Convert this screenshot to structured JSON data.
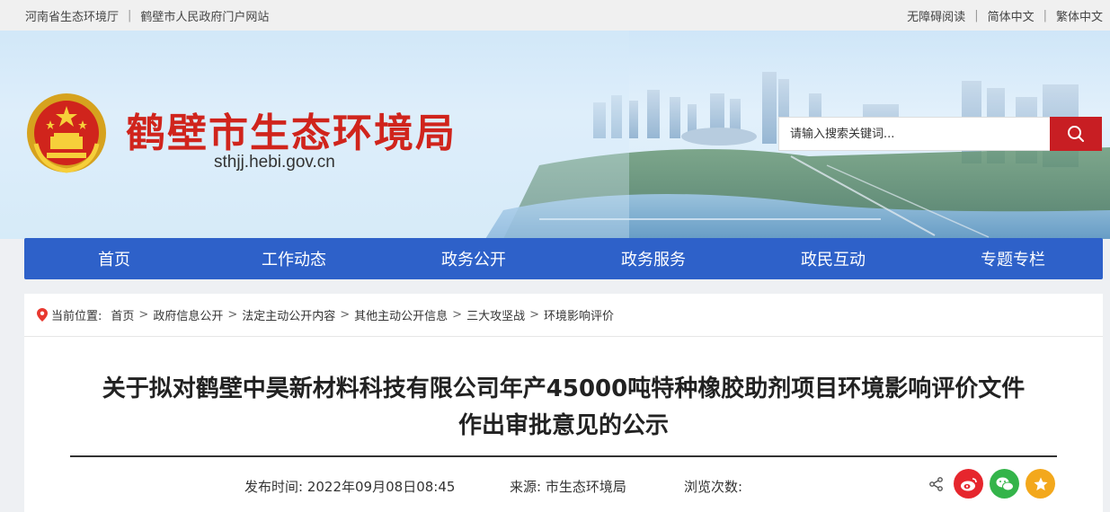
{
  "topbar": {
    "left_links": [
      "河南省生态环境厅",
      "鹤壁市人民政府门户网站"
    ],
    "right_links": [
      "无障碍阅读",
      "简体中文",
      "繁体中文"
    ]
  },
  "header": {
    "site_title": "鹤壁市生态环境局",
    "site_url": "sthjj.hebi.gov.cn",
    "search_placeholder": "请输入搜索关键词..."
  },
  "nav": {
    "items": [
      "首页",
      "工作动态",
      "政务公开",
      "政务服务",
      "政民互动",
      "专题专栏"
    ]
  },
  "breadcrumb": {
    "label": "当前位置:",
    "items": [
      "首页",
      "政府信息公开",
      "法定主动公开内容",
      "其他主动公开信息",
      "三大攻坚战",
      "环境影响评价"
    ]
  },
  "article": {
    "title_line1": "关于拟对鹤壁中昊新材料科技有限公司年产45000吨特种橡胶助剂项目环境影响评价文件",
    "title_line2": "作出审批意见的公示",
    "publish_label": "发布时间:",
    "publish_time": "2022年09月08日08:45",
    "source_label": "来源:",
    "source": "市生态环境局",
    "views_label": "浏览次数:"
  },
  "colors": {
    "nav_blue": "#2e61c9",
    "title_red": "#d0241c",
    "search_red": "#c81e23",
    "weibo": "#e6262d",
    "wechat": "#34b44a",
    "star": "#f3a81c"
  },
  "icons": [
    "location-pin-icon",
    "search-icon",
    "share-icon",
    "weibo-icon",
    "wechat-icon",
    "favorite-star-icon"
  ]
}
